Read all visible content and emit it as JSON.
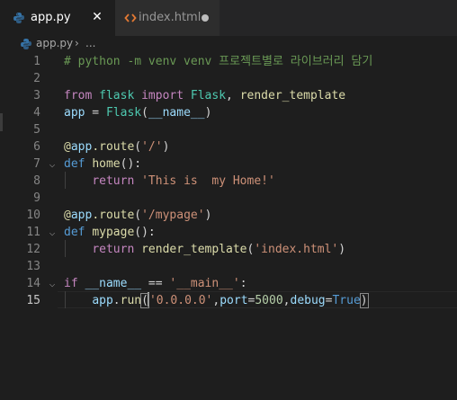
{
  "tabs": [
    {
      "label": "app.py",
      "icon": "python-file-icon",
      "active": true,
      "action_icon": "close-icon",
      "action_glyph": "✕"
    },
    {
      "label": "index.html",
      "icon": "html-file-icon",
      "active": false,
      "action_icon": "unsaved-dot-icon"
    }
  ],
  "breadcrumb": {
    "file": "app.py",
    "separator": "›",
    "more": "..."
  },
  "colors": {
    "python_icon": "#3572A5",
    "html_icon": "#e37933",
    "comment": "#6a9955",
    "keyword": "#c586c0",
    "def_keyword": "#569cd6",
    "function": "#dcdcaa",
    "variable": "#9cdcfe",
    "class": "#4ec9b0",
    "string": "#ce9178",
    "number": "#b5cea8"
  },
  "editor": {
    "current_line": 15,
    "lines": [
      {
        "number": "1",
        "tokens": [
          {
            "t": "# python -m venv venv 프로젝트별로 라이브러리 담기",
            "c": "comment"
          }
        ]
      },
      {
        "number": "2",
        "tokens": []
      },
      {
        "number": "3",
        "tokens": [
          {
            "t": "from",
            "c": "kw"
          },
          {
            "t": " ",
            "c": "plain"
          },
          {
            "t": "flask",
            "c": "cls"
          },
          {
            "t": " ",
            "c": "plain"
          },
          {
            "t": "import",
            "c": "kw"
          },
          {
            "t": " ",
            "c": "plain"
          },
          {
            "t": "Flask",
            "c": "cls"
          },
          {
            "t": ", ",
            "c": "plain"
          },
          {
            "t": "render_template",
            "c": "fn"
          }
        ]
      },
      {
        "number": "4",
        "tokens": [
          {
            "t": "app",
            "c": "var"
          },
          {
            "t": " = ",
            "c": "plain"
          },
          {
            "t": "Flask",
            "c": "cls"
          },
          {
            "t": "(",
            "c": "plain"
          },
          {
            "t": "__name__",
            "c": "var"
          },
          {
            "t": ")",
            "c": "plain"
          }
        ]
      },
      {
        "number": "5",
        "tokens": []
      },
      {
        "number": "6",
        "tokens": [
          {
            "t": "@",
            "c": "fn"
          },
          {
            "t": "app",
            "c": "var"
          },
          {
            "t": ".",
            "c": "fn"
          },
          {
            "t": "route",
            "c": "fn"
          },
          {
            "t": "(",
            "c": "plain"
          },
          {
            "t": "'/'",
            "c": "str"
          },
          {
            "t": ")",
            "c": "plain"
          }
        ]
      },
      {
        "number": "7",
        "fold": "⌵",
        "tokens": [
          {
            "t": "def",
            "c": "def"
          },
          {
            "t": " ",
            "c": "plain"
          },
          {
            "t": "home",
            "c": "fn"
          },
          {
            "t": "():",
            "c": "plain"
          }
        ]
      },
      {
        "number": "8",
        "indent": true,
        "tokens": [
          {
            "t": "    ",
            "c": "plain"
          },
          {
            "t": "return",
            "c": "kw"
          },
          {
            "t": " ",
            "c": "plain"
          },
          {
            "t": "'This is  my Home!'",
            "c": "str"
          }
        ]
      },
      {
        "number": "9",
        "tokens": []
      },
      {
        "number": "10",
        "tokens": [
          {
            "t": "@",
            "c": "fn"
          },
          {
            "t": "app",
            "c": "var"
          },
          {
            "t": ".",
            "c": "fn"
          },
          {
            "t": "route",
            "c": "fn"
          },
          {
            "t": "(",
            "c": "plain"
          },
          {
            "t": "'/mypage'",
            "c": "str"
          },
          {
            "t": ")",
            "c": "plain"
          }
        ]
      },
      {
        "number": "11",
        "fold": "⌵",
        "tokens": [
          {
            "t": "def",
            "c": "def"
          },
          {
            "t": " ",
            "c": "plain"
          },
          {
            "t": "mypage",
            "c": "fn"
          },
          {
            "t": "():",
            "c": "plain"
          }
        ]
      },
      {
        "number": "12",
        "indent": true,
        "tokens": [
          {
            "t": "    ",
            "c": "plain"
          },
          {
            "t": "return",
            "c": "kw"
          },
          {
            "t": " ",
            "c": "plain"
          },
          {
            "t": "render_template",
            "c": "fn"
          },
          {
            "t": "(",
            "c": "plain"
          },
          {
            "t": "'index.html'",
            "c": "str"
          },
          {
            "t": ")",
            "c": "plain"
          }
        ]
      },
      {
        "number": "13",
        "tokens": []
      },
      {
        "number": "14",
        "fold": "⌵",
        "tokens": [
          {
            "t": "if",
            "c": "kw"
          },
          {
            "t": " ",
            "c": "plain"
          },
          {
            "t": "__name__",
            "c": "var"
          },
          {
            "t": " == ",
            "c": "plain"
          },
          {
            "t": "'__main__'",
            "c": "str"
          },
          {
            "t": ":",
            "c": "plain"
          }
        ]
      },
      {
        "number": "15",
        "indent": true,
        "tokens": [
          {
            "t": "    ",
            "c": "plain"
          },
          {
            "t": "app",
            "c": "var"
          },
          {
            "t": ".",
            "c": "plain"
          },
          {
            "t": "run",
            "c": "fn"
          },
          {
            "t": "(",
            "c": "plain",
            "match": true,
            "cursor_after": true
          },
          {
            "t": "'0.0.0.0'",
            "c": "str"
          },
          {
            "t": ",",
            "c": "plain"
          },
          {
            "t": "port",
            "c": "var"
          },
          {
            "t": "=",
            "c": "plain"
          },
          {
            "t": "5000",
            "c": "num"
          },
          {
            "t": ",",
            "c": "plain"
          },
          {
            "t": "debug",
            "c": "var"
          },
          {
            "t": "=",
            "c": "plain"
          },
          {
            "t": "True",
            "c": "def"
          },
          {
            "t": ")",
            "c": "plain",
            "match": true
          }
        ]
      }
    ]
  }
}
